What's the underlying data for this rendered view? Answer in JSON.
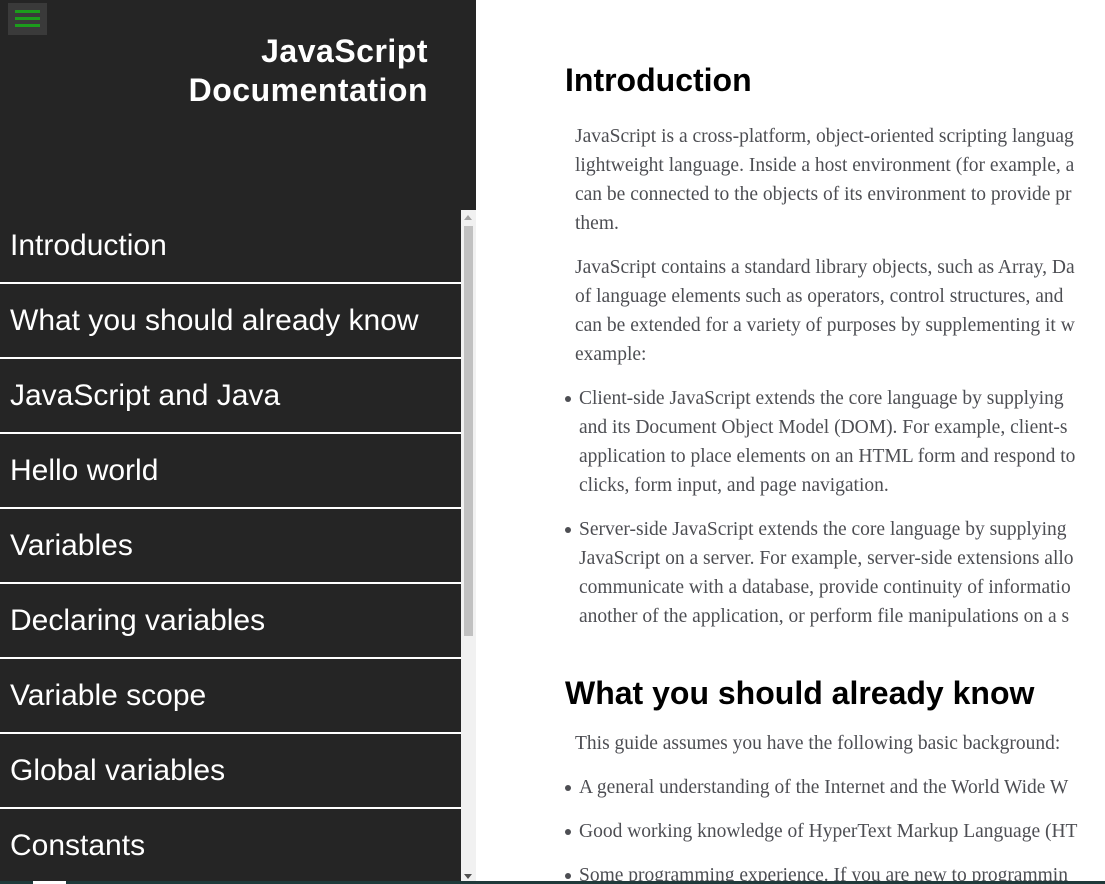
{
  "sidebar": {
    "title_line1": "JavaScript",
    "title_line2": "Documentation",
    "items": [
      {
        "label": "Introduction"
      },
      {
        "label": "What you should already know"
      },
      {
        "label": "JavaScript and Java"
      },
      {
        "label": "Hello world"
      },
      {
        "label": "Variables"
      },
      {
        "label": "Declaring variables"
      },
      {
        "label": "Variable scope"
      },
      {
        "label": "Global variables"
      },
      {
        "label": "Constants"
      }
    ]
  },
  "main": {
    "intro": {
      "heading": "Introduction",
      "p1": [
        "JavaScript is a cross-platform, object-oriented scripting languag",
        "lightweight language. Inside a host environment (for example, a",
        "can be connected to the objects of its environment to provide pr",
        "them."
      ],
      "p2": [
        "JavaScript contains a standard library objects, such as Array, Da",
        "of language elements such as operators, control structures, and",
        "can be extended for a variety of purposes by supplementing it w",
        "example:"
      ],
      "bullets": [
        [
          "Client-side JavaScript extends the core language by supplying",
          "and its Document Object Model (DOM). For example, client-s",
          "application to place elements on an HTML form and respond to",
          "clicks, form input, and page navigation."
        ],
        [
          "Server-side JavaScript extends the core language by supplying",
          "JavaScript on a server. For example, server-side extensions allo",
          "communicate with a database, provide continuity of informatio",
          "another of the application, or perform file manipulations on a s"
        ]
      ]
    },
    "know": {
      "heading": "What you should already know",
      "p1": "This guide assumes you have the following basic background:",
      "bullets": [
        "A general understanding of the Internet and the World Wide W",
        "Good working knowledge of HyperText Markup Language (HT",
        "Some programming experience. If you are new to programmin"
      ]
    }
  },
  "colors": {
    "sidebar_bg": "#252525",
    "menu_icon": "#1c9d1c",
    "body_text": "#4d4e53"
  },
  "icons": {
    "menu": "hamburger-menu-icon"
  }
}
